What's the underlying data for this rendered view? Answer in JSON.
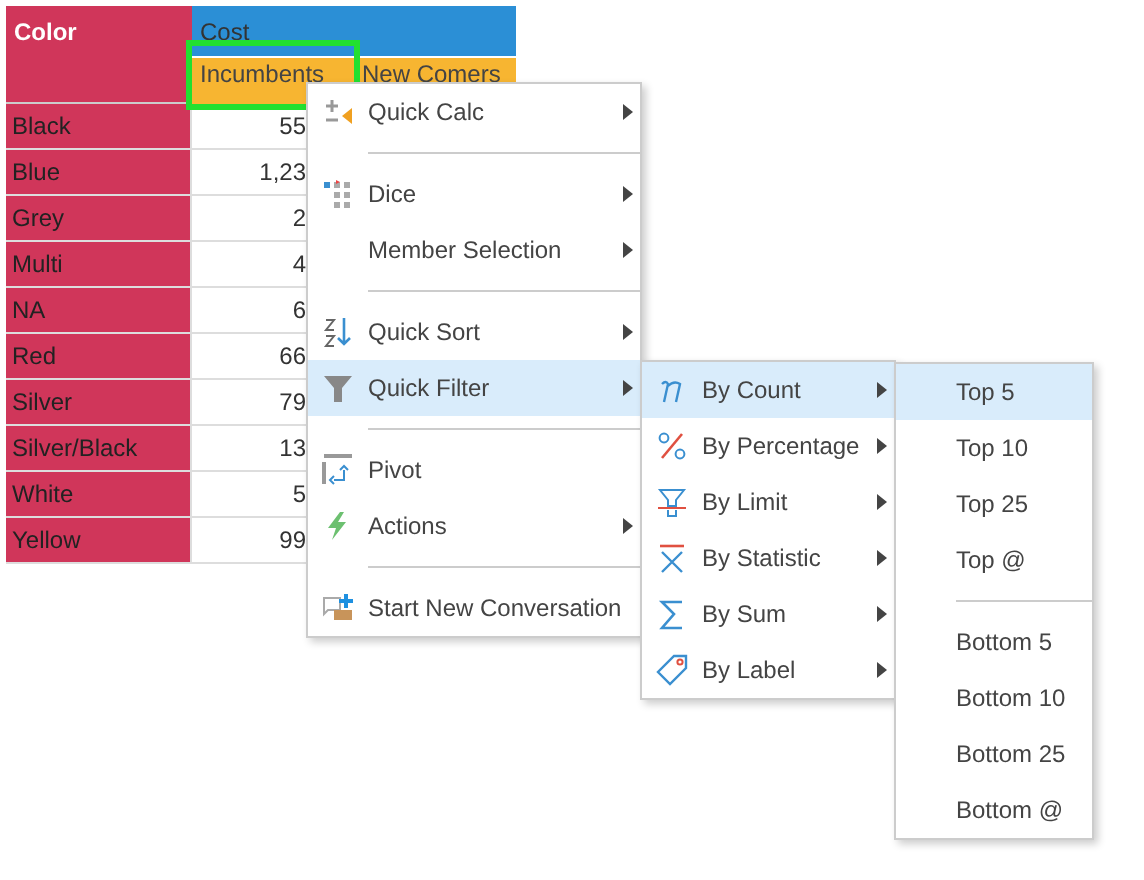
{
  "table": {
    "row_header": "Color",
    "group_header": "Cost",
    "subcolumns": [
      {
        "label": "Incumbents",
        "selected": true
      },
      {
        "label": "New Comers",
        "selected": false
      }
    ],
    "rows": [
      {
        "label": "Black",
        "value": "55"
      },
      {
        "label": "Blue",
        "value": "1,23"
      },
      {
        "label": "Grey",
        "value": "2"
      },
      {
        "label": "Multi",
        "value": "4"
      },
      {
        "label": "NA",
        "value": "6"
      },
      {
        "label": "Red",
        "value": "66"
      },
      {
        "label": "Silver",
        "value": "79"
      },
      {
        "label": "Silver/Black",
        "value": "13"
      },
      {
        "label": "White",
        "value": "5"
      },
      {
        "label": "Yellow",
        "value": "99"
      }
    ]
  },
  "context_menu": {
    "groups": [
      [
        {
          "label": "Quick Calc",
          "selected": false,
          "has_submenu": true
        }
      ],
      [
        {
          "label": "Dice",
          "selected": false,
          "has_submenu": true
        },
        {
          "label": "Member Selection",
          "selected": false,
          "has_submenu": true
        }
      ],
      [
        {
          "label": "Quick Sort",
          "selected": false,
          "has_submenu": true
        },
        {
          "label": "Quick Filter",
          "selected": true,
          "has_submenu": true
        }
      ],
      [
        {
          "label": "Pivot",
          "selected": false,
          "has_submenu": false
        },
        {
          "label": "Actions",
          "selected": false,
          "has_submenu": true
        }
      ],
      [
        {
          "label": "Start New Conversation",
          "selected": false,
          "has_submenu": false
        }
      ]
    ]
  },
  "filter_submenu": {
    "items": [
      {
        "label": "By Count",
        "selected": true,
        "has_submenu": true
      },
      {
        "label": "By Percentage",
        "selected": false,
        "has_submenu": true
      },
      {
        "label": "By Limit",
        "selected": false,
        "has_submenu": true
      },
      {
        "label": "By Statistic",
        "selected": false,
        "has_submenu": true
      },
      {
        "label": "By Sum",
        "selected": false,
        "has_submenu": true
      },
      {
        "label": "By Label",
        "selected": false,
        "has_submenu": true
      }
    ]
  },
  "count_submenu": {
    "groups": [
      [
        {
          "label": "Top 5",
          "selected": true
        },
        {
          "label": "Top 10",
          "selected": false
        },
        {
          "label": "Top 25",
          "selected": false
        },
        {
          "label": "Top @",
          "selected": false
        }
      ],
      [
        {
          "label": "Bottom 5",
          "selected": false
        },
        {
          "label": "Bottom 10",
          "selected": false
        },
        {
          "label": "Bottom 25",
          "selected": false
        },
        {
          "label": "Bottom @",
          "selected": false
        }
      ]
    ]
  }
}
